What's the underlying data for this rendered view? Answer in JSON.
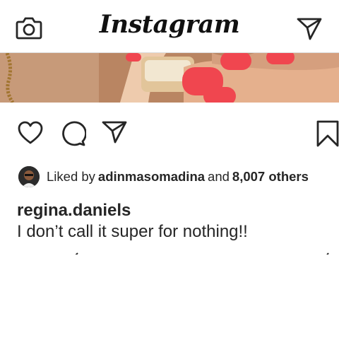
{
  "header": {
    "logo": "Instagram",
    "camera_icon": "camera-icon",
    "direct_icon": "paper-plane-icon"
  },
  "post": {
    "actions": {
      "like_icon": "heart-icon",
      "comment_icon": "comment-icon",
      "share_icon": "paper-plane-icon",
      "save_icon": "bookmark-icon"
    },
    "likes": {
      "prefix": "Liked by",
      "user": "adinmasomadina",
      "joiner": "and",
      "others": "8,007 others"
    },
    "caption": {
      "username": "regina.daniels",
      "text": "I don’t call it super for nothing!!"
    }
  },
  "colors": {
    "text": "#262626",
    "divider": "#dbdbdb",
    "nail": "#f0464f",
    "skin": "#e9b48f"
  }
}
